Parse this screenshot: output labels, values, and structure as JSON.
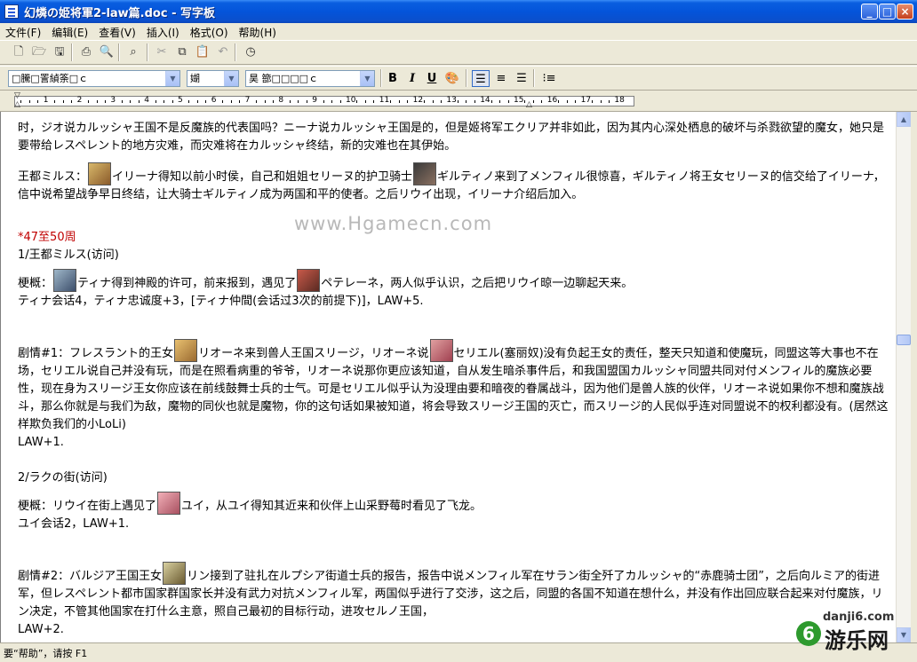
{
  "window": {
    "title": "幻燐の姫将軍2-law篇.doc - 写字板",
    "controls": {
      "minimize": "_",
      "maximize": "□",
      "close": "×"
    }
  },
  "menu": [
    "文件(F)",
    "编辑(E)",
    "查看(V)",
    "插入(I)",
    "格式(O)",
    "帮助(H)"
  ],
  "toolbar": {
    "icons": [
      "new-document-icon",
      "open-folder-icon",
      "save-icon",
      "print-icon",
      "print-preview-icon",
      "find-icon",
      "cut-icon",
      "copy-icon",
      "paste-icon",
      "undo-icon",
      "insert-datetime-icon"
    ]
  },
  "format_bar": {
    "font_name": "□騰□詈緽筡□ｃ",
    "font_size": "媩",
    "script": "昊  篰□□□□ｃ",
    "bold": "B",
    "italic": "I",
    "underline": "U",
    "icons": [
      "color-icon",
      "align-left-icon",
      "align-center-icon",
      "align-right-icon",
      "bullets-icon"
    ]
  },
  "ruler": {
    "numbers": [
      "1",
      "2",
      "3",
      "4",
      "5",
      "6",
      "7",
      "8",
      "9",
      "10",
      "11",
      "12",
      "13",
      "14",
      "15",
      "16",
      "17",
      "18"
    ]
  },
  "document": {
    "p1": "时，ジオ说カルッシャ王国不是反魔族的代表国吗？ニーナ说カルッシャ王国是的，但是姬将军エクリア并非如此，因为其内心深处栖息的破坏与杀戮欲望的魔女，她只是要带给レスペレント的地方灾难，而灾难将在カルッシャ终结，新的灾难也在其伊始。",
    "p2a": "王都ミルス：",
    "p2b": "イリーナ得知以前小时侯，自己和姐姐セリーヌ的护卫骑士",
    "p2c": "ギルティノ来到了メンフィル很惊喜，ギルティノ将王女セリーヌ的信交给了イリーナ，信中说希望战争早日终结，让大骑士ギルティノ成为两国和平的使者。之后リウイ出现，イリーナ介绍后加入。",
    "h1": "*47至50周",
    "s1": "1/王都ミルス(访问)",
    "p3a": "梗概：",
    "p3b": "ティナ得到神殿的许可，前来报到，遇见了",
    "p3c": "ペテレーネ，两人似乎认识，之后把リウイ晾一边聊起天来。",
    "p3d": "ティナ会话4，ティナ忠诚度+3，[ティナ仲間(会话过3次的前提下)]，LAW+5.",
    "p4a": "剧情#1：フレスラント的王女",
    "p4b": "リオーネ来到兽人王国スリージ，リオーネ说",
    "p4c": "セリエル(塞丽奴)没有负起王女的责任，整天只知道和使魔玩，同盟这等大事也不在场，セリエル说自己并没有玩，而是在照看病重的爷爷，リオーネ说那你更应该知道，自从发生暗杀事件后，和我国盟国カルッシャ同盟共同对付メンフィル的魔族必要性，现在身为スリージ王女你应该在前线鼓舞士兵的士气。可是セリエル似乎认为没理由要和暗夜的眷属战斗，因为他们是兽人族的伙伴，リオーネ说如果你不想和魔族战斗，那么你就是与我们为敌，魔物的同伙也就是魔物，你的这句话如果被知道，将会导致スリージ王国的灭亡，而スリージ的人民似乎连对同盟说不的权利都没有。(居然这样欺负我们的小LoLi)",
    "p4d": "LAW+1.",
    "s2": "2/ラクの街(访问)",
    "p5a": "梗概：リウイ在街上遇见了",
    "p5b": "ユイ，从ユイ得知其近来和伙伴上山采野莓时看见了飞龙。",
    "p5c": "ユイ会话2，LAW+1.",
    "p6a": "剧情#2：バルジア王国王女",
    "p6b": "リン接到了驻扎在ルプシア街道士兵的报告，报告中说メンフィル军在サラン街全歼了カルッシャ的“赤鹿骑士团”，之后向ルミア的街进军，但レスペレント都市国家群国家长并没有武力对抗メンフィル军，两国似乎进行了交涉，这之后，同盟的各国不知道在想什么，并没有作出回应联合起来对付魔族，リン决定，不管其他国家在打什么主意，照自己最初的目标行动，进攻セルノ王国，",
    "p6c": "LAW+2.",
    "watermark": "www.Hgamecn.com"
  },
  "status": "要“帮助”，请按 F1",
  "site_logo": {
    "domain": "danji6.com",
    "mark": "6",
    "name": "游乐网"
  }
}
